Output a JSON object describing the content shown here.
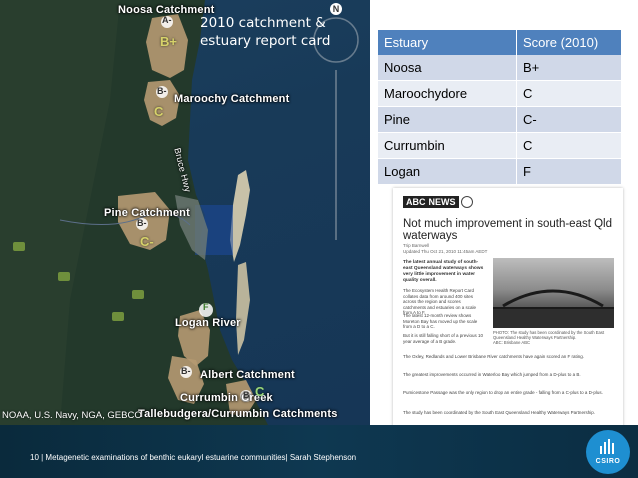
{
  "map": {
    "title_lines": [
      "2010 catchment &",
      "estuary report card"
    ],
    "labels": {
      "noosa": "Noosa Catchment",
      "maroochy": "Maroochy Catchment",
      "pine": "Pine Catchment",
      "logan": "Logan River",
      "albert": "Albert Catchment",
      "currumbin": "Currumbin Creek",
      "tallebudgera": "Tallebudgera/Currumbin Catchments",
      "bruce_hwy": "Bruce Hwy"
    },
    "grades": {
      "noosa_catch": "A-",
      "noosa_est": "B+",
      "maroochy_catch": "B-",
      "maroochy_est": "C",
      "pine_catch": "B-",
      "pine_est": "C-",
      "logan_catch": "F",
      "albert_catch": "B-",
      "currumbin_catch": "B",
      "currumbin_est": "C"
    },
    "credits": "NOAA, U.S. Navy, NGA, GEBCO",
    "nav_symbol": "N",
    "colors": {
      "catchment": "#b69a72",
      "sea": "#1b3f5e",
      "land": "#1f3a2a",
      "highlight_water": "#1e4a9e"
    }
  },
  "table": {
    "headers": [
      "Estuary",
      "Score (2010)"
    ],
    "rows": [
      [
        "Noosa",
        "B+"
      ],
      [
        "Maroochydore",
        "C"
      ],
      [
        "Pine",
        "C-"
      ],
      [
        "Currumbin",
        "C"
      ],
      [
        "Logan",
        "F"
      ]
    ],
    "colors": {
      "header": "#4f81bd",
      "row_odd": "#d0d8e8",
      "row_even": "#e9edf4"
    }
  },
  "news": {
    "logo_abc": "ABC",
    "logo_news": "NEWS",
    "headline": "Not much improvement in south-east Qld waterways",
    "byline_1": "Trip Barnwell",
    "byline_2": "Updated Thu Oct 21, 2010 11:45am AEDT",
    "lead": "The latest annual study of south-east Queensland waterways shows very little improvement in water quality overall.",
    "para_1": "The Ecosystem Health Report Card collates data from around 400 sites across the region and scores catchments and estuaries on a scale from A to F.",
    "para_2": "The latest 12-month review shows Moreton Bay has moved up the scale from a D to a C.",
    "para_3": "But it is still falling short of a previous 10 year average of a B grade.",
    "para_4": "The Oxley, Redlands and Lower Brisbane River catchments have again scored an F rating.",
    "para_5": "The greatest improvements occurred in Waterloo Bay which jumped from a D-plus to a B.",
    "para_6": "Pumicestone Passage was the only region to drop an entire grade - falling from a C-plus to a D-plus.",
    "para_7": "The study has been coordinated by the South East Queensland Healthy Waterways Partnership.",
    "photo_caption": "PHOTO: The study has been coordinated by the South East Queensland Healthy Waterways Partnership.",
    "photo_credit": "ABC: Brisbane ABC"
  },
  "footer": {
    "text": "10  |  Metagenetic examinations of benthic eukaryl estuarine communities| Sarah Stephenson",
    "logo_text": "CSIRO",
    "colors": {
      "background": "#0e3851",
      "logo": "#1e8fd1"
    }
  }
}
